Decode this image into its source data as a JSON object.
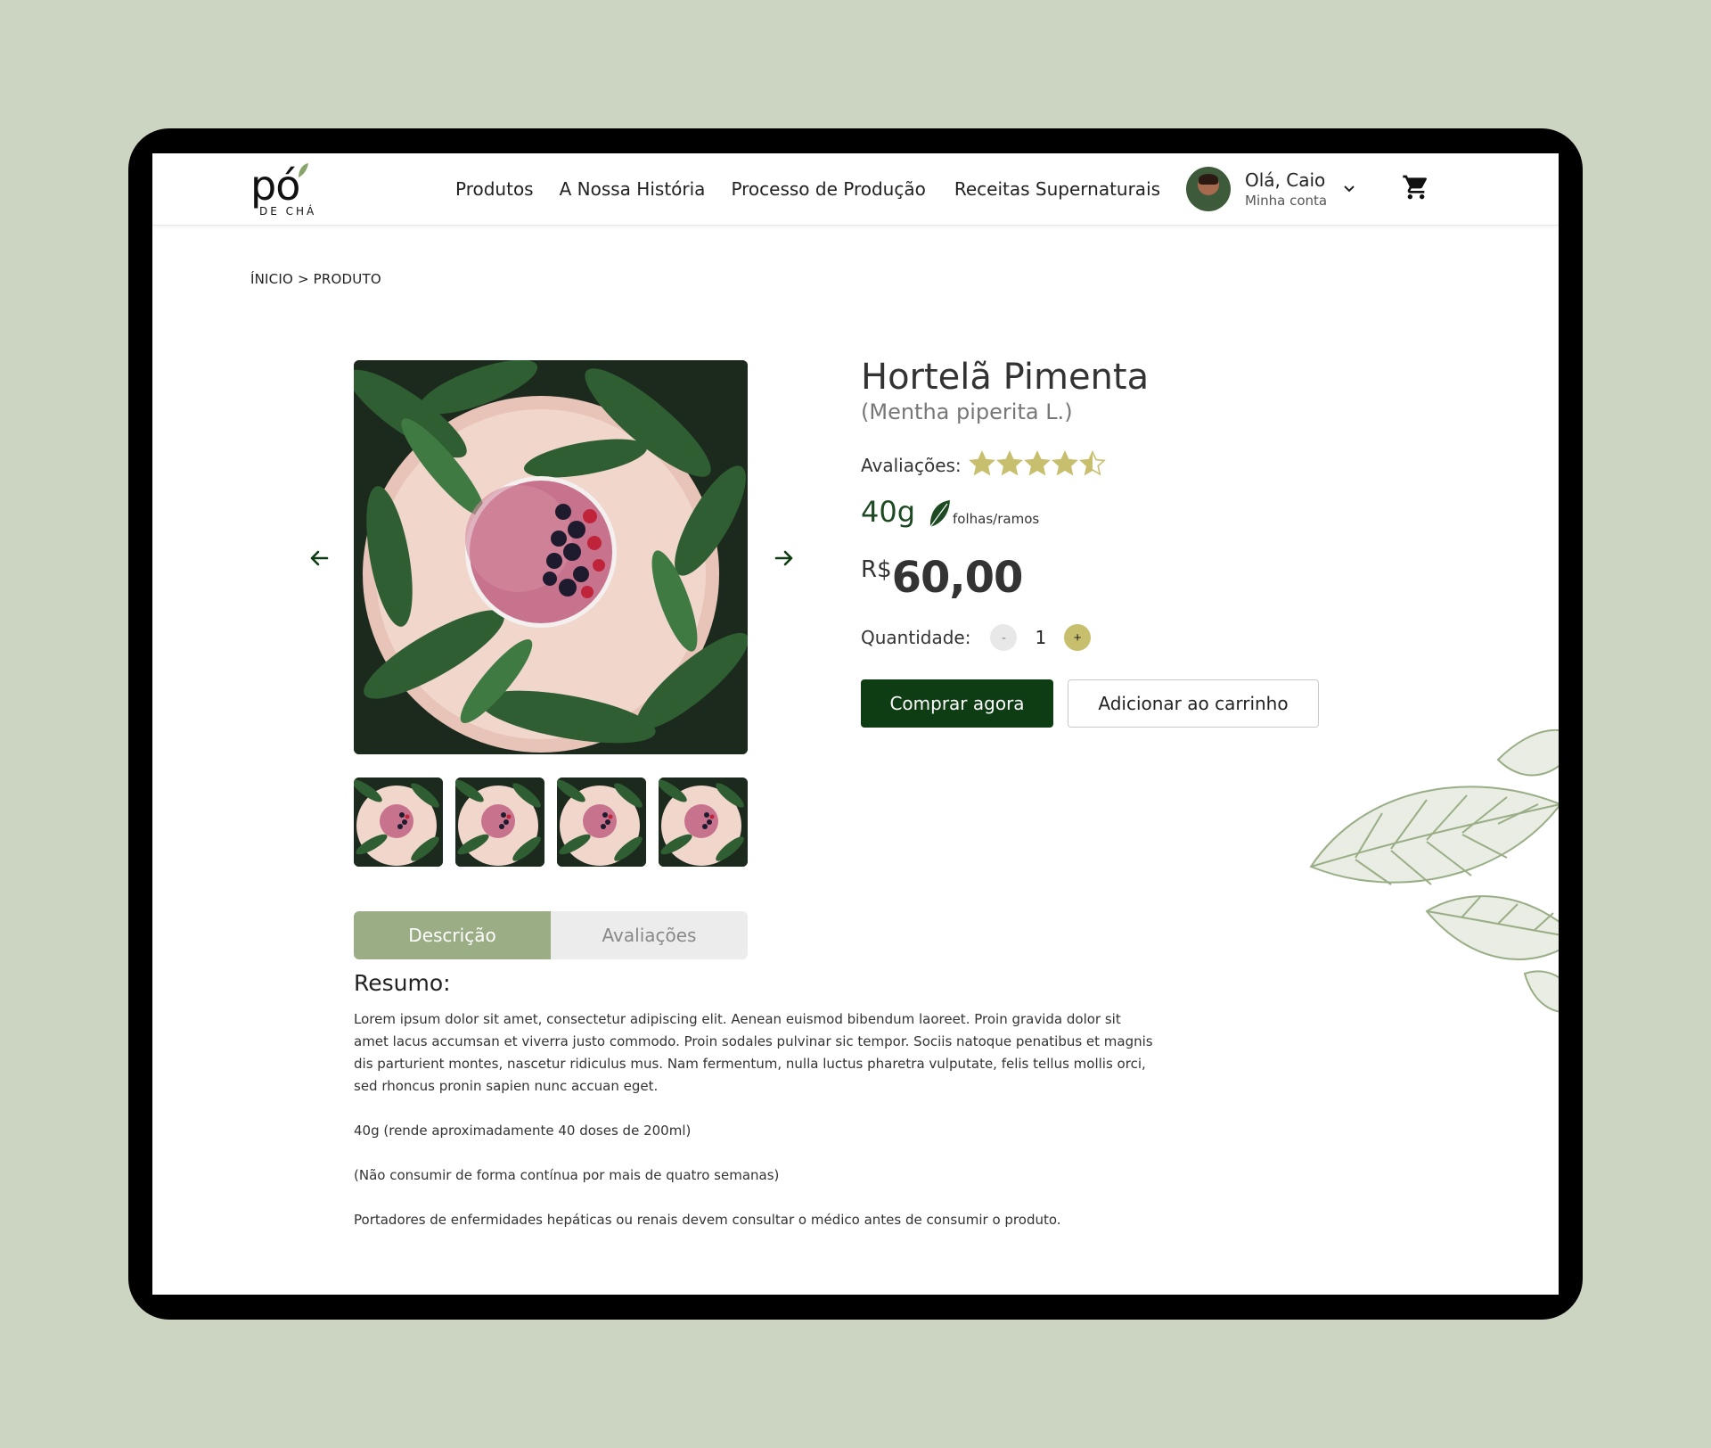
{
  "brand": {
    "logo_main": "pó",
    "logo_sub": "DE CHÁ"
  },
  "nav": {
    "items": [
      {
        "label": "Produtos"
      },
      {
        "label": "A Nossa História"
      },
      {
        "label": "Processo de Produção"
      },
      {
        "label": "Receitas Supernaturais"
      }
    ]
  },
  "account": {
    "greeting": "Olá, Caio",
    "subtitle": "Minha conta"
  },
  "breadcrumb": "ÍNICIO > PRODUTO",
  "product": {
    "title": "Hortelã Pimenta",
    "scientific_name": "(Mentha piperita L.)",
    "ratings_label": "Avaliações:",
    "rating": 4.5,
    "rating_max": 5,
    "weight": "40g",
    "weight_type": "folhas/ramos",
    "currency": "R$",
    "price": "60,00",
    "quantity_label": "Quantidade:",
    "quantity": "1",
    "minus": "-",
    "plus": "+",
    "buy_label": "Comprar agora",
    "cart_label": "Adicionar ao carrinho",
    "thumbnails": 4
  },
  "tabs": [
    {
      "label": "Descrição",
      "active": true
    },
    {
      "label": "Avaliações",
      "active": false
    }
  ],
  "description": {
    "title": "Resumo:",
    "paragraphs": [
      "Lorem ipsum dolor sit amet, consectetur adipiscing elit. Aenean euismod bibendum laoreet. Proin gravida dolor sit amet lacus accumsan et viverra justo commodo. Proin sodales pulvinar sic tempor. Sociis natoque penatibus et magnis dis parturient montes, nascetur ridiculus mus. Nam fermentum, nulla luctus pharetra vulputate, felis tellus mollis orci, sed rhoncus pronin sapien nunc accuan eget.",
      "40g (rende aproximadamente 40 doses de 200ml)",
      "(Não consumir de forma contínua por mais de quatro semanas)",
      "Portadores de enfermidades hepáticas ou renais devem consultar o médico antes de consumir o produto."
    ]
  },
  "colors": {
    "background": "#cbd5c1",
    "primary_green": "#0e3d13",
    "tab_active": "#9aad84",
    "star": "#c8bf6e"
  }
}
